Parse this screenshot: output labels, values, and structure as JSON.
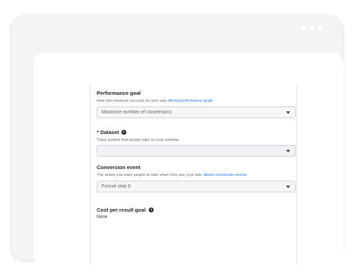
{
  "performance_goal": {
    "title": "Performance goal",
    "description": "How you measure success for your ads.",
    "link": "About performance goals",
    "value": "Maximize number of conversions"
  },
  "dataset": {
    "required_mark": "*",
    "title": "Dataset",
    "description": "Track actions that people take on your website.",
    "value": ""
  },
  "conversion_event": {
    "title": "Conversion event",
    "description": "The action you want people to take when they see your ads.",
    "link": "About conversion events",
    "value": "Funnel step 6"
  },
  "cost_per_result": {
    "title": "Cost per result goal",
    "value": "None"
  },
  "icons": {
    "info": "info-icon",
    "dropdown": "chevron-down-icon"
  }
}
